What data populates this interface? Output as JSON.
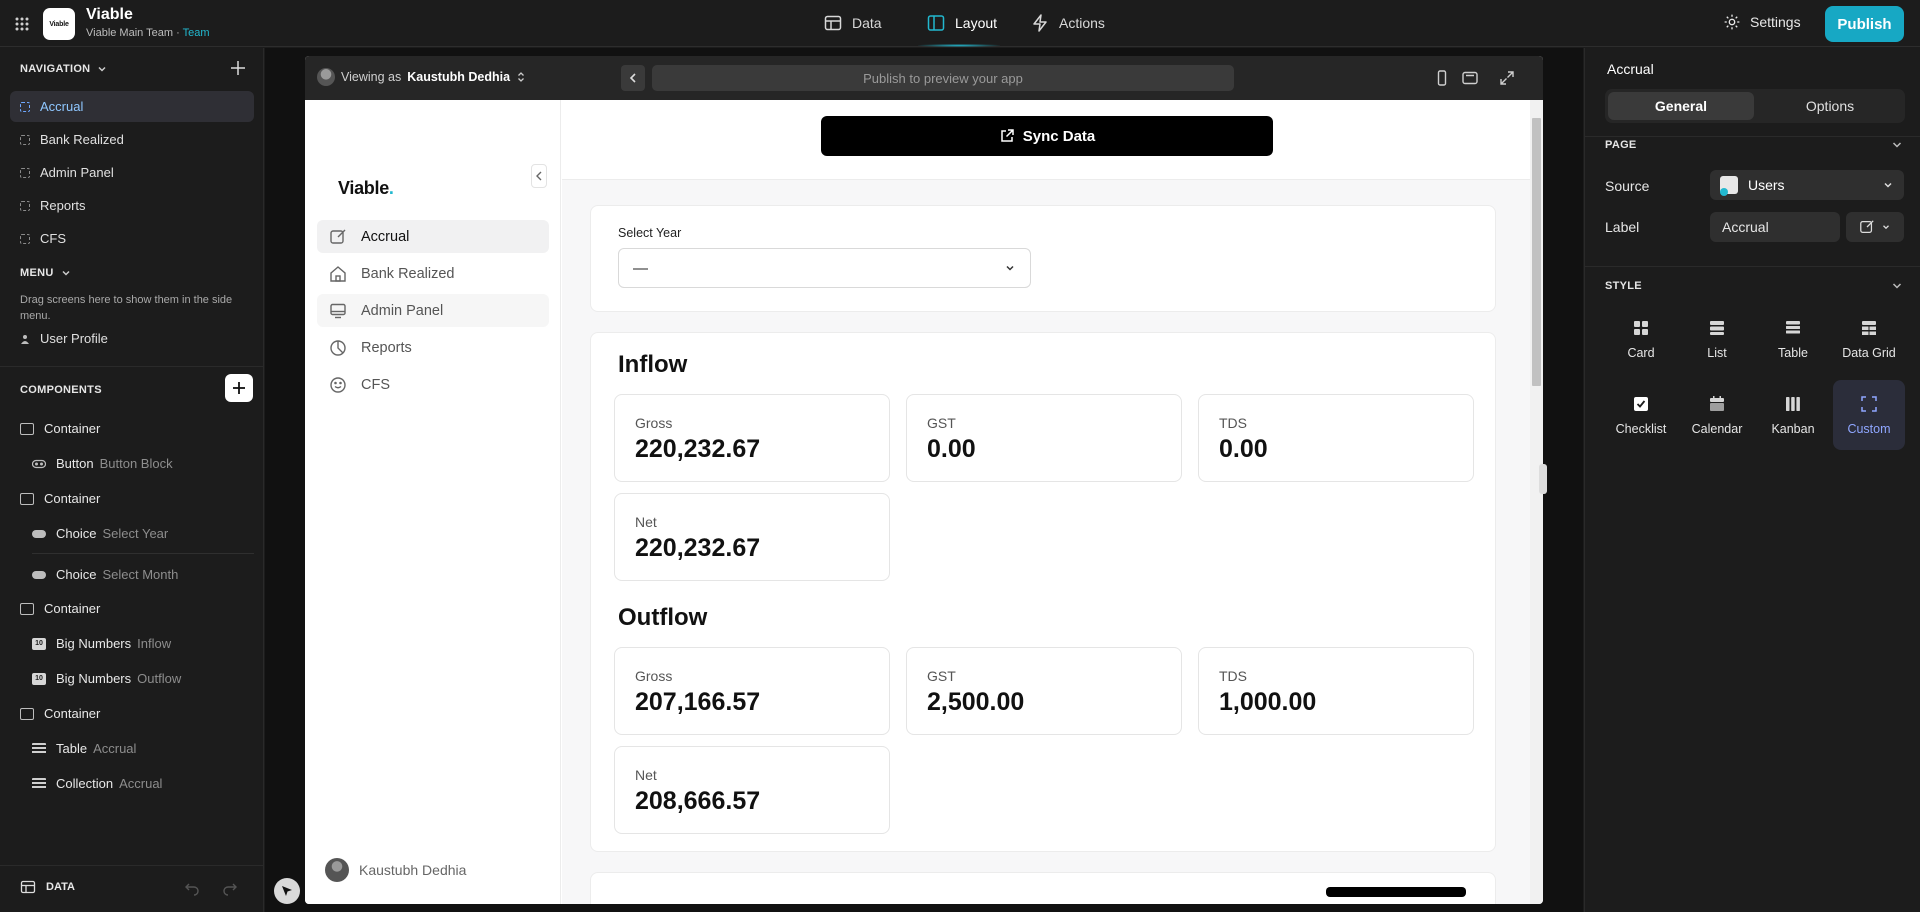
{
  "topbar": {
    "logo_text": "Viable",
    "app_title": "Viable",
    "team_name": "Viable Main Team",
    "team_sep": "·",
    "team_badge": "Team",
    "tabs": [
      {
        "label": "Data",
        "icon": "table-icon"
      },
      {
        "label": "Layout",
        "icon": "layout-icon"
      },
      {
        "label": "Actions",
        "icon": "bolt-icon"
      }
    ],
    "active_tab": "Layout",
    "settings_label": "Settings",
    "publish_label": "Publish",
    "accent_color": "#22b8cf"
  },
  "left": {
    "navigation_header": "NAVIGATION",
    "nav_items": [
      "Accrual",
      "Bank Realized",
      "Admin Panel",
      "Reports",
      "CFS"
    ],
    "active_nav": "Accrual",
    "menu_header": "MENU",
    "menu_hint": "Drag screens here to show them in the side menu.",
    "menu_items": [
      "User Profile"
    ],
    "components_header": "COMPONENTS",
    "components": [
      {
        "name": "Container",
        "sub": ""
      },
      {
        "name": "Button",
        "sub": "Button Block"
      },
      {
        "name": "Container",
        "sub": ""
      },
      {
        "name": "Choice",
        "sub": "Select Year"
      },
      {
        "name": "Choice",
        "sub": "Select Month"
      },
      {
        "name": "Container",
        "sub": ""
      },
      {
        "name": "Big Numbers",
        "sub": "Inflow"
      },
      {
        "name": "Big Numbers",
        "sub": "Outflow"
      },
      {
        "name": "Container",
        "sub": ""
      },
      {
        "name": "Table",
        "sub": "Accrual"
      },
      {
        "name": "Collection",
        "sub": "Accrual"
      }
    ],
    "footer_label": "DATA"
  },
  "preview": {
    "viewing_prefix": "Viewing as",
    "viewing_user": "Kaustubh Dedhia",
    "url_placeholder": "Publish to preview your app",
    "app_logo": "Viable",
    "app_logo_dot": ".",
    "app_nav": [
      {
        "label": "Accrual",
        "icon": "edit-square-icon"
      },
      {
        "label": "Bank Realized",
        "icon": "bank-icon"
      },
      {
        "label": "Admin Panel",
        "icon": "monitor-icon"
      },
      {
        "label": "Reports",
        "icon": "pie-chart-icon"
      },
      {
        "label": "CFS",
        "icon": "smile-icon"
      }
    ],
    "app_user": "Kaustubh Dedhia",
    "sync_label": "Sync Data",
    "select_year_label": "Select Year",
    "select_year_value": "—",
    "inflow": {
      "title": "Inflow",
      "stats": [
        {
          "label": "Gross",
          "value": "220,232.67"
        },
        {
          "label": "GST",
          "value": "0.00"
        },
        {
          "label": "TDS",
          "value": "0.00"
        },
        {
          "label": "Net",
          "value": "220,232.67"
        }
      ]
    },
    "outflow": {
      "title": "Outflow",
      "stats": [
        {
          "label": "Gross",
          "value": "207,166.57"
        },
        {
          "label": "GST",
          "value": "2,500.00"
        },
        {
          "label": "TDS",
          "value": "1,000.00"
        },
        {
          "label": "Net",
          "value": "208,666.57"
        }
      ]
    }
  },
  "right": {
    "title": "Accrual",
    "tab_general": "General",
    "tab_options": "Options",
    "page_header": "PAGE",
    "source_label": "Source",
    "source_value": "Users",
    "label_label": "Label",
    "label_value": "Accrual",
    "style_header": "STYLE",
    "styles": [
      {
        "label": "Card",
        "icon": "card-icon"
      },
      {
        "label": "List",
        "icon": "list-icon"
      },
      {
        "label": "Table",
        "icon": "table-icon"
      },
      {
        "label": "Data Grid",
        "icon": "data-grid-icon"
      },
      {
        "label": "Checklist",
        "icon": "checklist-icon"
      },
      {
        "label": "Calendar",
        "icon": "calendar-icon"
      },
      {
        "label": "Kanban",
        "icon": "kanban-icon"
      },
      {
        "label": "Custom",
        "icon": "custom-frame-icon"
      }
    ],
    "active_style": "Custom",
    "active_color": "#8fa6ff"
  }
}
